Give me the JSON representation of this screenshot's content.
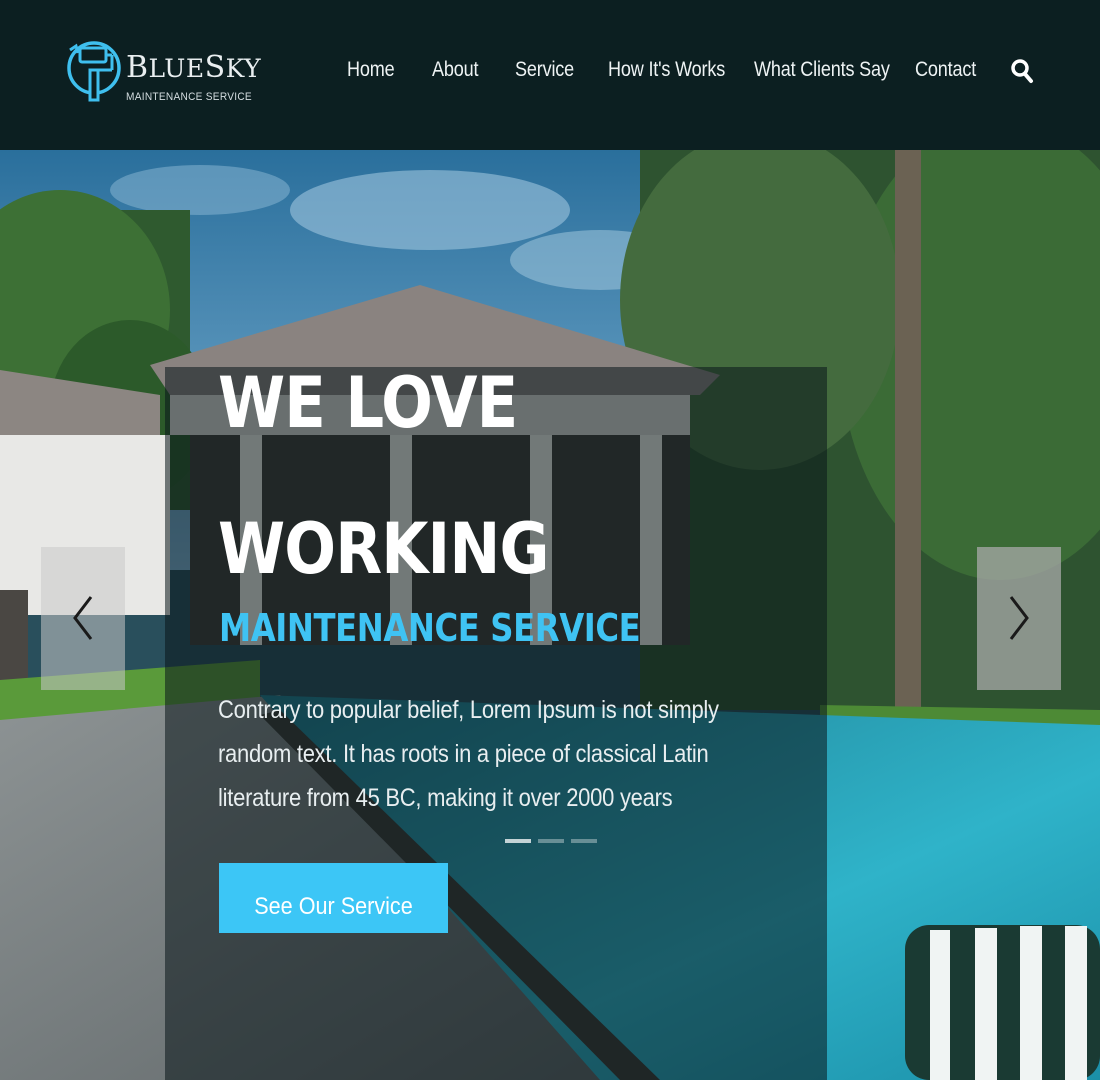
{
  "brand": {
    "name_cap_first": "B",
    "name_rest": "LUE",
    "name_cap_second": "S",
    "name_rest_second": "KY",
    "tagline": "MAINTENANCE SERVICE",
    "accent_color": "#3fc3f3"
  },
  "nav": {
    "items": [
      {
        "label": "Home"
      },
      {
        "label": "About"
      },
      {
        "label": "Service"
      },
      {
        "label": "How It's Works"
      },
      {
        "label": "What Clients Say"
      },
      {
        "label": "Contact"
      }
    ],
    "search_icon": "search-icon"
  },
  "hero": {
    "headline_line1": "WE LOVE",
    "headline_line2": "WORKING",
    "subheadline": "MAINTENANCE SERVICE",
    "description": "Contrary to popular belief, Lorem Ipsum is not simply random text. It has roots in a piece of classical Latin literature from 45 BC, making it over 2000 years",
    "cta_label": "See Our Service",
    "cta_color": "#3cc6f6",
    "prev_icon": "chevron-left-icon",
    "next_icon": "chevron-right-icon",
    "slides_total": 3,
    "slide_active": 1
  }
}
